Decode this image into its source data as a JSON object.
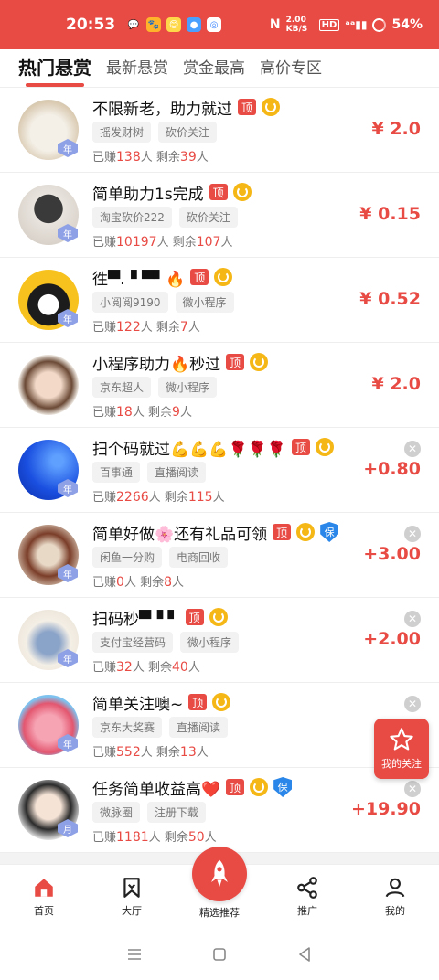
{
  "status": {
    "time": "20:53",
    "net_speed": "2.00 KB/S",
    "battery": "54%"
  },
  "tabs": [
    {
      "label": "热门悬赏",
      "active": true
    },
    {
      "label": "最新悬赏",
      "active": false
    },
    {
      "label": "赏金最高",
      "active": false
    },
    {
      "label": "高价专区",
      "active": false
    }
  ],
  "items": [
    {
      "title": "不限新老，助力就过",
      "tags": [
        "摇发财树",
        "砍价关注"
      ],
      "earned": "138",
      "remaining": "39",
      "price": "¥ 2.0",
      "badge": "年"
    },
    {
      "title": "简单助力1s完成",
      "tags": [
        "淘宝砍价222",
        "砍价关注"
      ],
      "earned": "10197",
      "remaining": "107",
      "price": "¥ 0.15",
      "badge": "年"
    },
    {
      "title": "徃▀.▝ ▀▘🔥",
      "tags": [
        "小阅阅9190",
        "微小程序"
      ],
      "earned": "122",
      "remaining": "7",
      "price": "¥ 0.52",
      "badge": "年"
    },
    {
      "title": "小程序助力🔥秒过",
      "tags": [
        "京东超人",
        "微小程序"
      ],
      "earned": "18",
      "remaining": "9",
      "price": "¥ 2.0",
      "badge": ""
    },
    {
      "title": "扫个码就过💪💪💪🌹🌹🌹",
      "tags": [
        "百事通",
        "直播阅读"
      ],
      "earned": "2266",
      "remaining": "115",
      "price": "+0.80",
      "badge": "年"
    },
    {
      "title": "简单好做🌸还有礼品可领",
      "tags": [
        "闲鱼一分购",
        "电商回收"
      ],
      "earned": "0",
      "remaining": "8",
      "price": "+3.00",
      "badge": "年"
    },
    {
      "title": "扫码秒▀▝ ▘",
      "tags": [
        "支付宝经营码",
        "微小程序"
      ],
      "earned": "32",
      "remaining": "40",
      "price": "+2.00",
      "badge": "年"
    },
    {
      "title": "简单关注噢~",
      "tags": [
        "京东大奖赛",
        "直播阅读"
      ],
      "earned": "552",
      "remaining": "13",
      "price": "",
      "badge": "年"
    },
    {
      "title": "任务简单收益高❤️",
      "tags": [
        "微脉圈",
        "注册下载"
      ],
      "earned": "1181",
      "remaining": "50",
      "price": "+19.90",
      "badge": "月"
    }
  ],
  "labels": {
    "ding": "顶",
    "bao": "保",
    "earned_prefix": "已赚",
    "person": "人",
    "remaining_prefix": "剩余",
    "close": "✕"
  },
  "float_follow": {
    "label": "我的关注"
  },
  "nav": {
    "home": "首页",
    "hall": "大厅",
    "featured": "精选推荐",
    "promote": "推广",
    "mine": "我的"
  },
  "colors": {
    "accent": "#e84a44",
    "refresh": "#f5b716",
    "bao": "#2a86e8"
  }
}
